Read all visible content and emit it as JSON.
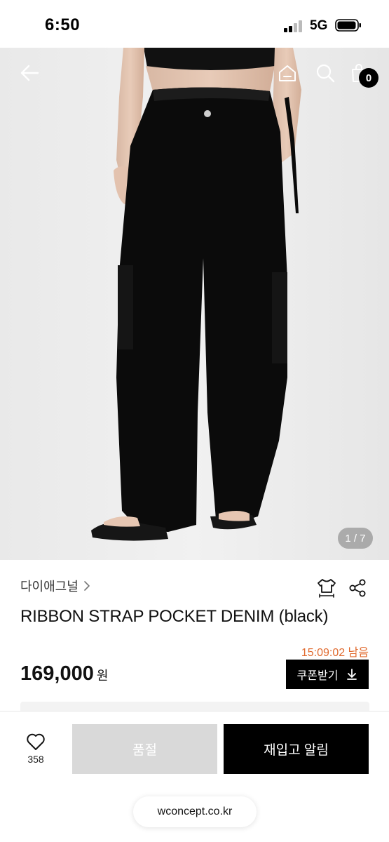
{
  "status_bar": {
    "time": "6:50",
    "network": "5G"
  },
  "header": {
    "cart_count": "0",
    "icons": [
      "back-arrow-icon",
      "home-icon",
      "search-icon",
      "cart-icon"
    ]
  },
  "gallery": {
    "indicator": "1 / 7",
    "current": 1,
    "total": 7
  },
  "product": {
    "brand": "다이애그널",
    "title": "RIBBON STRAP POCKET DENIM (black)",
    "time_left": "15:09:02 남음",
    "price": "169,000",
    "currency": "원",
    "coupon_label": "쿠폰받기"
  },
  "actions": {
    "like_count": "358",
    "sold_out_label": "품절",
    "restock_label": "재입고 알림"
  },
  "browser": {
    "url": "wconcept.co.kr"
  },
  "colors": {
    "accent_timer": "#e0692d",
    "primary": "#000000",
    "disabled": "#d9d9d9"
  }
}
